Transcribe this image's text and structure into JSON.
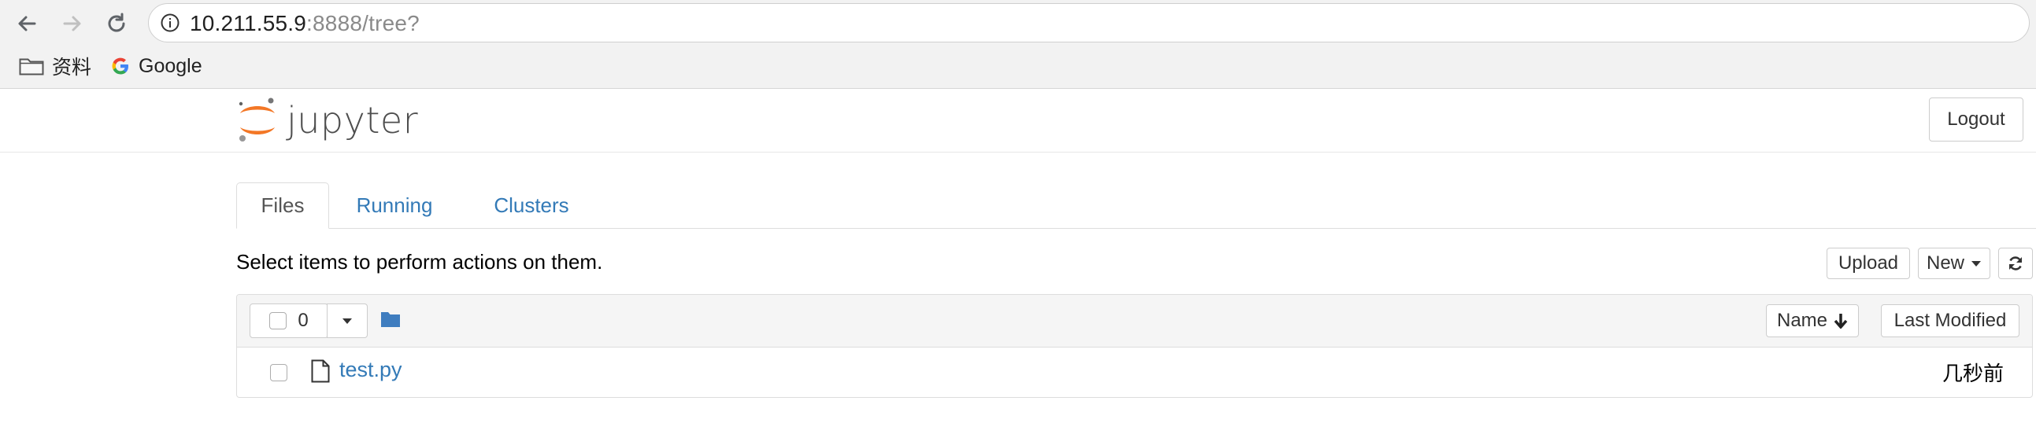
{
  "browser": {
    "url_host": "10.211.55.9",
    "url_rest": ":8888/tree?",
    "bookmarks": [
      {
        "label": "资料",
        "icon": "folder-icon"
      },
      {
        "label": "Google",
        "icon": "google-icon"
      }
    ]
  },
  "header": {
    "logo_text": "jupyter",
    "logout_label": "Logout"
  },
  "tabs": [
    {
      "label": "Files",
      "active": true
    },
    {
      "label": "Running",
      "active": false
    },
    {
      "label": "Clusters",
      "active": false
    }
  ],
  "toolbar": {
    "instructions": "Select items to perform actions on them.",
    "upload_label": "Upload",
    "new_label": "New",
    "refresh_icon": "refresh-icon"
  },
  "list": {
    "selected_count": "0",
    "sort_name_label": "Name",
    "sort_modified_label": "Last Modified",
    "items": [
      {
        "name": "test.py",
        "modified": "几秒前",
        "icon": "file-icon"
      }
    ]
  },
  "colors": {
    "link": "#337ab7",
    "jupyter_orange": "#f37726",
    "folder_blue": "#3f7dbf"
  }
}
